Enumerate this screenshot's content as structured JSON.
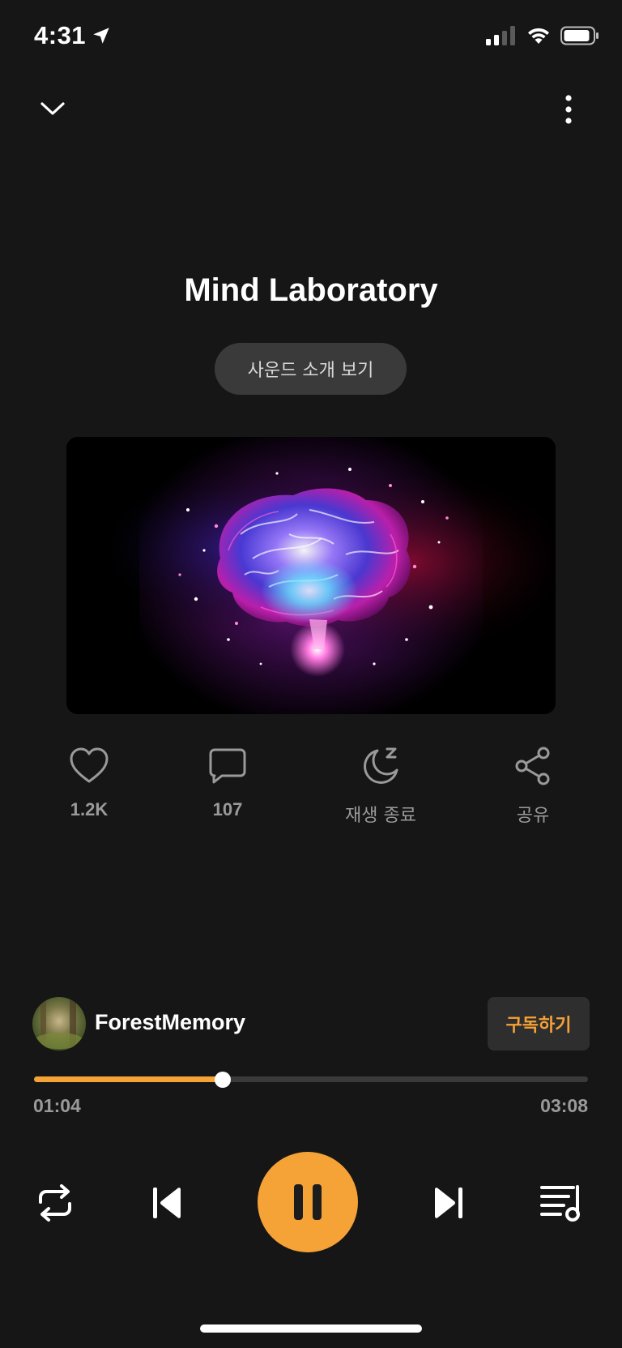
{
  "status_bar": {
    "time": "4:31",
    "location_icon": "location-arrow-icon",
    "signal_icon": "cellular-signal-icon",
    "wifi_icon": "wifi-icon",
    "battery_icon": "battery-icon"
  },
  "header": {
    "collapse_icon": "chevron-down-icon",
    "more_icon": "more-vertical-icon"
  },
  "track": {
    "title": "Mind Laboratory",
    "intro_button_label": "사운드 소개 보기",
    "artwork_icon": "glowing-brain-image"
  },
  "actions": [
    {
      "icon": "heart-icon",
      "label": "1.2K"
    },
    {
      "icon": "comment-icon",
      "label": "107"
    },
    {
      "icon": "sleep-timer-icon",
      "label": "재생 종료"
    },
    {
      "icon": "share-icon",
      "label": "공유"
    }
  ],
  "channel": {
    "name": "ForestMemory",
    "subscribe_label": "구독하기"
  },
  "progress": {
    "current": "01:04",
    "total": "03:08",
    "fraction": 0.34
  },
  "controls": {
    "repeat_icon": "repeat-icon",
    "previous_icon": "skip-previous-icon",
    "pause_icon": "pause-icon",
    "next_icon": "skip-next-icon",
    "playlist_icon": "playlist-icon"
  },
  "colors": {
    "accent": "#f5a236",
    "background": "#161616",
    "muted_text": "#9a9a9a",
    "pill_bg": "#3a3a3a"
  }
}
